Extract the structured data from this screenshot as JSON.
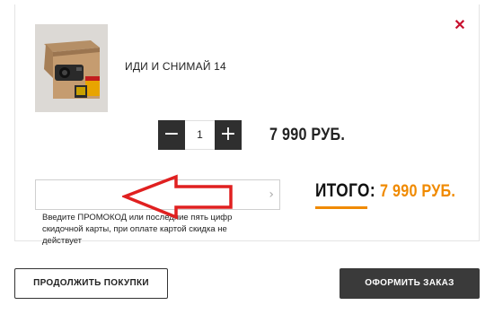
{
  "product": {
    "name": "ИДИ И СНИМАЙ 14",
    "image_icon": "film-camera-kit-image"
  },
  "quantity": {
    "value": "1",
    "decrement_label": "−",
    "increment_label": "+"
  },
  "price": {
    "item": "7 990 РУБ."
  },
  "promo": {
    "value": "",
    "placeholder": "",
    "hint": "Введите ПРОМОКОД или последние пять цифр скидочной карты, при оплате картой скидка не действует"
  },
  "total": {
    "label": "ИТОГО:",
    "value": "7 990 РУБ."
  },
  "buttons": {
    "continue_label": "ПРОДОЛЖИТЬ ПОКУПКИ",
    "checkout_label": "ОФОРМИТЬ ЗАКАЗ"
  },
  "colors": {
    "accent": "#f08a00",
    "close": "#c8102e",
    "dark_button": "#3a3a3a",
    "annotation": "#e02020"
  }
}
